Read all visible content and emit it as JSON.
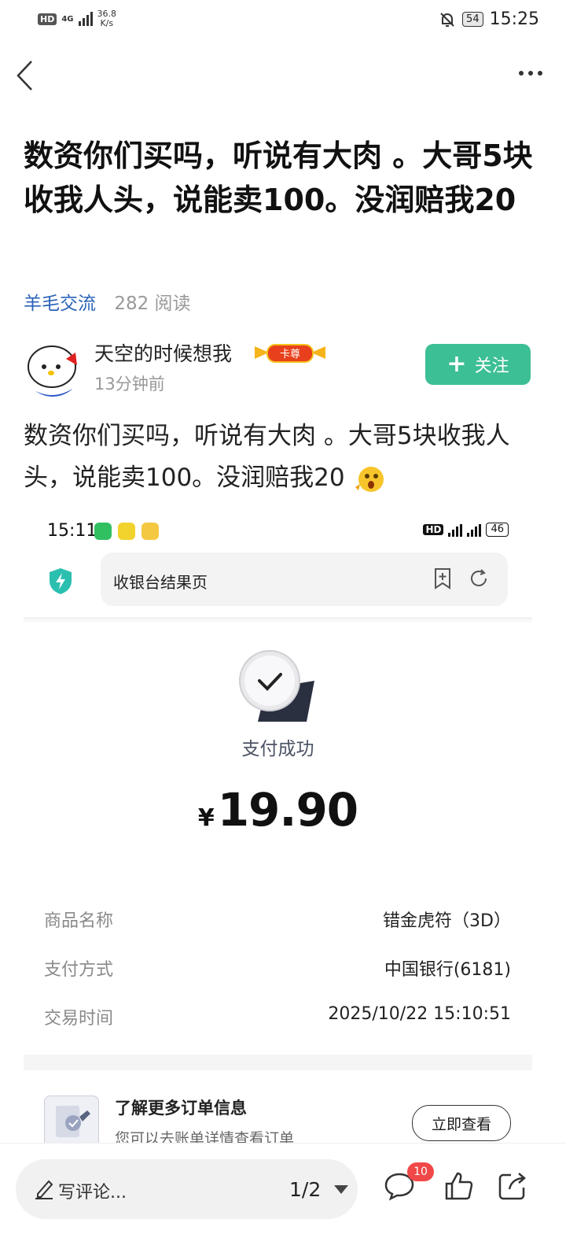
{
  "status_bar": {
    "hd": "HD",
    "net": "4G",
    "speed_value": "36.8",
    "speed_unit": "K/s",
    "battery": "54",
    "time": "15:25"
  },
  "post": {
    "title": "数资你们买吗，听说有大肉 。大哥5块收我人头，说能卖100。没润赔我20",
    "category": "羊毛交流",
    "reads": "282 阅读",
    "author": "天空的时候想我",
    "author_badge": "卡尊",
    "time_ago": "13分钟前",
    "follow_label": "关注",
    "body": "数资你们买吗，听说有大肉 。大哥5块收我人头，说能卖100。没润赔我20"
  },
  "screenshot": {
    "status_time": "15:11",
    "battery": "46",
    "page_title": "收银台结果页",
    "pay_status": "支付成功",
    "currency": "¥",
    "amount": "19.90",
    "rows": [
      {
        "label": "商品名称",
        "value": "错金虎符（3D）"
      },
      {
        "label": "支付方式",
        "value": "中国银行(6181)"
      },
      {
        "label": "交易时间",
        "value": "2025/10/22 15:10:51"
      }
    ],
    "more_title": "了解更多订单信息",
    "more_sub": "您可以去账单详情查看订单",
    "view_button": "立即查看"
  },
  "bottom_bar": {
    "comment_placeholder": "写评论...",
    "pager": "1/2",
    "comment_count": "10"
  }
}
